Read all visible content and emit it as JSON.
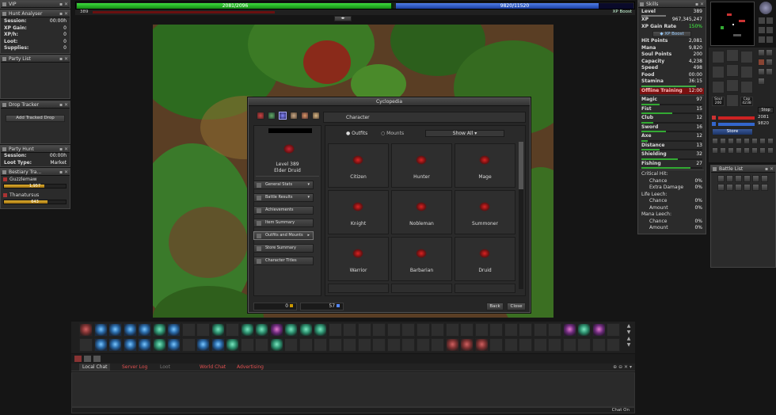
{
  "hp_bar": {
    "text": "2081/2096",
    "fraction": 0.993
  },
  "mana_bar": {
    "text": "9820/11520",
    "fraction": 0.852
  },
  "level_small": "389",
  "xp_boost_label": "XP Boost",
  "vip": {
    "title": "VIP"
  },
  "hunt_analyser": {
    "title": "Hunt Analyser",
    "rows": [
      {
        "label": "Session:",
        "value": "00:00h"
      },
      {
        "label": "XP Gain:",
        "value": "0"
      },
      {
        "label": "XP/h:",
        "value": "0"
      },
      {
        "label": "Loot:",
        "value": "0"
      },
      {
        "label": "Supplies:",
        "value": "0"
      }
    ]
  },
  "party_list": {
    "title": "Party List"
  },
  "drop_tracker": {
    "title": "Drop Tracker",
    "button": "Add Tracked Drop"
  },
  "party_hunt": {
    "title": "Party Hunt",
    "rows": [
      {
        "label": "Session:",
        "value": "00:00h"
      },
      {
        "label": "Loot Type:",
        "value": "Market"
      }
    ]
  },
  "bestiary": {
    "title": "Bestiary Tra...",
    "entries": [
      {
        "name": "Guzzlemaw",
        "count": "1,957",
        "progress": 0.65
      },
      {
        "name": "Thanatursus",
        "count": "643",
        "progress": 0.7
      }
    ]
  },
  "cyclopedia": {
    "title": "Cyclopedia",
    "character_tab": "Character",
    "level_line": "Level 389",
    "vocation": "Elder Druid",
    "menu": [
      {
        "label": "General Stats",
        "arrow": "▾"
      },
      {
        "label": "Battle Results",
        "arrow": "▾"
      },
      {
        "label": "Achievements",
        "arrow": ""
      },
      {
        "label": "Item Summary",
        "arrow": ""
      },
      {
        "label": "Outfits and Mounts",
        "arrow": "▸"
      },
      {
        "label": "Store Summary",
        "arrow": ""
      },
      {
        "label": "Character Titles",
        "arrow": ""
      }
    ],
    "tabs": {
      "outfits": "Outfits",
      "mounts": "Mounts"
    },
    "filter": "Show All",
    "outfits": [
      "Citizen",
      "Hunter",
      "Mage",
      "Knight",
      "Nobleman",
      "Summoner",
      "Warrior",
      "Barbarian",
      "Druid"
    ],
    "coins_left": "0",
    "coins_right": "57",
    "back_btn": "Back",
    "close_btn": "Close"
  },
  "skills": {
    "title": "Skills",
    "level_label": "Level",
    "level_value": "389",
    "xp_rows": [
      {
        "label": "XP",
        "value": "967,345,247"
      },
      {
        "label": "XP Gain Rate",
        "value": "150%"
      }
    ],
    "xp_boost_btn": "XP Boost",
    "stats": [
      {
        "label": "Hit Points",
        "value": "2,081"
      },
      {
        "label": "Mana",
        "value": "9,820"
      },
      {
        "label": "Soul Points",
        "value": "200"
      },
      {
        "label": "Capacity",
        "value": "4,238"
      },
      {
        "label": "Speed",
        "value": "498"
      },
      {
        "label": "Food",
        "value": "00:00"
      },
      {
        "label": "Stamina",
        "value": "36:15"
      }
    ],
    "offline_label": "Offline Training",
    "offline_value": "12:00",
    "skill_rows": [
      {
        "label": "Magic",
        "value": "97",
        "progress": 0.3
      },
      {
        "label": "Fist",
        "value": "15",
        "progress": 0.5
      },
      {
        "label": "Club",
        "value": "12",
        "progress": 0.2
      },
      {
        "label": "Sword",
        "value": "16",
        "progress": 0.4
      },
      {
        "label": "Axe",
        "value": "12",
        "progress": 0.1
      },
      {
        "label": "Distance",
        "value": "13",
        "progress": 0.3
      },
      {
        "label": "Shielding",
        "value": "32",
        "progress": 0.6
      },
      {
        "label": "Fishing",
        "value": "27",
        "progress": 0.8
      }
    ],
    "extra_rows": [
      {
        "label": "Critical Hit:",
        "value": ""
      },
      {
        "label": "Chance",
        "value": "0%"
      },
      {
        "label": "Extra Damage",
        "value": "0%"
      },
      {
        "label": "Life Leech:",
        "value": ""
      },
      {
        "label": "Chance",
        "value": "0%"
      },
      {
        "label": "Amount",
        "value": "0%"
      },
      {
        "label": "Mana Leech:",
        "value": ""
      },
      {
        "label": "Chance",
        "value": "0%"
      },
      {
        "label": "Amount",
        "value": "0%"
      }
    ]
  },
  "inventory": {
    "soul": "200",
    "soul_label": "Soul",
    "cap": "4238",
    "cap_label": "Cap",
    "stop_label": "Stop",
    "hp_value": "2081",
    "mana_value": "9820",
    "store_btn": "Store"
  },
  "battle_list": {
    "title": "Battle List"
  },
  "chat": {
    "tabs": [
      "Local Chat",
      "Server Log",
      "Loot",
      "World Chat",
      "Advertising"
    ],
    "chat_on": "Chat On"
  },
  "colors": {
    "hp": "#1fae1f",
    "mana": "#2456c8",
    "offline": "#b41a1a"
  }
}
